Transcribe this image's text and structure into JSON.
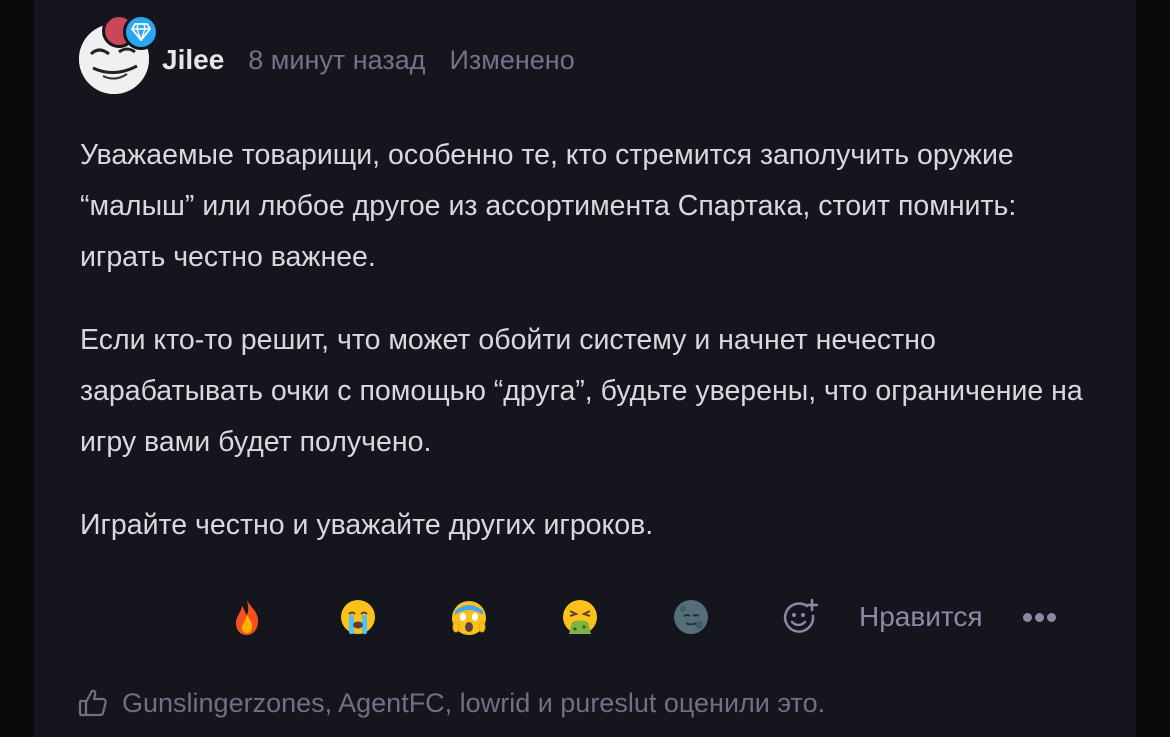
{
  "post": {
    "author": "Jilee",
    "time": "8 минут назад",
    "edited": "Изменено",
    "paragraphs": [
      "Уважаемые товарищи, особенно те, кто стремится заполучить оружие “малыш” или любое другое из ассортимента Спартака, стоит помнить: играть честно важнее.",
      "Если кто-то решит, что может обойти систему и начнет нечестно зарабатывать очки с помощью “друга”, будьте уверены, что ограничение на игру вами будет получено.",
      "Играйте честно и уважайте других игроков."
    ]
  },
  "reactions": {
    "items": [
      {
        "icon": "fire-emoji-icon"
      },
      {
        "icon": "crying-face-emoji-icon"
      },
      {
        "icon": "screaming-face-emoji-icon"
      },
      {
        "icon": "vomiting-face-emoji-icon"
      },
      {
        "icon": "new-moon-face-emoji-icon"
      }
    ],
    "add_icon": "add-reaction-icon",
    "like_label": "Нравится",
    "more_icon": "more-icon"
  },
  "likes": {
    "icon": "thumbs-up-icon",
    "text": "Gunslingerzones, AgentFC, lowrid и pureslut оценили это."
  },
  "colors": {
    "background": "#0a0a0d",
    "card": "#15151d",
    "text": "#d8d8de",
    "muted": "#72728a",
    "badge_blue": "#2aa7f0",
    "badge_red": "#c8485a"
  }
}
